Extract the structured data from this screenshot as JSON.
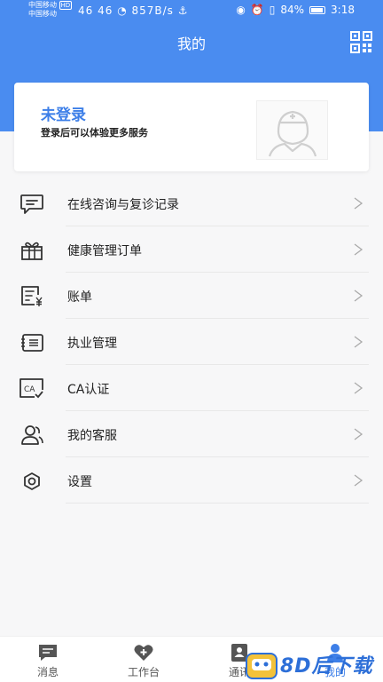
{
  "status_bar": {
    "carrier_1": "中国移动",
    "carrier_1_badge": "HD",
    "carrier_2": "中国移动",
    "signal_text": "46 46",
    "speed": "857B/s",
    "battery": "84%",
    "time": "3:18"
  },
  "header": {
    "title": "我的"
  },
  "login_card": {
    "title": "未登录",
    "subtitle": "登录后可以体验更多服务"
  },
  "menu": [
    {
      "label": "在线咨询与复诊记录",
      "icon": "chat-bubble-icon"
    },
    {
      "label": "健康管理订单",
      "icon": "gift-icon"
    },
    {
      "label": "账单",
      "icon": "bill-icon"
    },
    {
      "label": "执业管理",
      "icon": "practice-card-icon"
    },
    {
      "label": "CA认证",
      "icon": "ca-certificate-icon"
    },
    {
      "label": "我的客服",
      "icon": "customer-service-icon"
    },
    {
      "label": "设置",
      "icon": "gear-icon"
    }
  ],
  "tabbar": [
    {
      "label": "消息",
      "active": false
    },
    {
      "label": "工作台",
      "active": false
    },
    {
      "label": "通讯",
      "active": false
    },
    {
      "label": "我的",
      "active": true
    }
  ],
  "watermark": {
    "text": "8D后下载"
  },
  "colors": {
    "primary": "#4a8cf0",
    "accent_text": "#3d7fe8"
  }
}
